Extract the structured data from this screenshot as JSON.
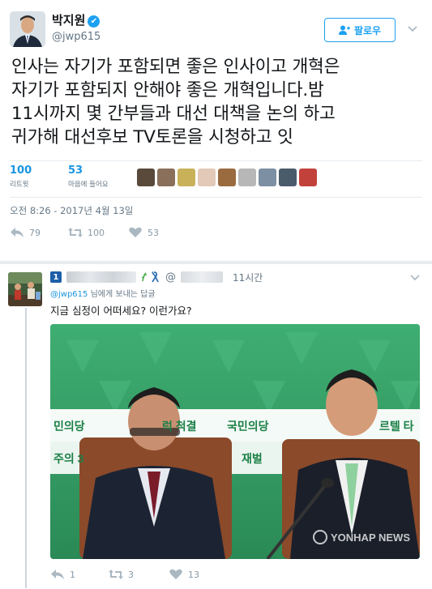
{
  "tweet": {
    "display_name": "박지원",
    "verified_glyph": "✔",
    "handle": "@jwp615",
    "follow_label": "팔로우",
    "text_lines": [
      "인사는 자기가 포함되면 좋은 인사이고 개혁은",
      "자기가 포함되지 안해야 좋은 개혁입니다.밤",
      "11시까지 몇 간부들과 대선 대책을 논의 하고",
      "귀가해 대선후보 TV토론을 시청하고 잇"
    ],
    "retweets": {
      "count": "100",
      "label": "리트윗"
    },
    "likes": {
      "count": "53",
      "label": "마음에 들어요"
    },
    "liker_avatar_colors": [
      "#5a4a3c",
      "#8a6f5b",
      "#c9b15a",
      "#e3c9b8",
      "#9a6b3f",
      "#b7b7b7",
      "#7c8fa3",
      "#4a5b6a",
      "#c2413a"
    ],
    "timestamp": "오전 8:26 - 2017년 4월 13일",
    "actions": {
      "reply_count": "79",
      "retweet_count": "100",
      "like_count": "53"
    },
    "icons": {
      "reply": "reply-icon",
      "retweet": "retweet-icon",
      "like": "heart-icon",
      "follow": "add-user-icon",
      "menu": "chevron-down-icon"
    }
  },
  "reply": {
    "badge": "1",
    "at": "@",
    "time": "11시간",
    "reply_to_mention": "@jwp615",
    "reply_to_suffix": " 님에게 보내는 답글",
    "text": "지금 심정이 어떠세요? 이런가요?",
    "media": {
      "watermark": "YONHAP NEWS",
      "visible_signage": [
        "민의당",
        "럭 척결",
        "국민의당",
        "르텔 타",
        "주의 3",
        "재벌"
      ]
    },
    "actions": {
      "reply_count": "1",
      "retweet_count": "3",
      "like_count": "13"
    }
  },
  "colors": {
    "accent": "#1da1f2",
    "link": "#1b95e0",
    "muted": "#657786",
    "party_green": "#2f9a63"
  }
}
